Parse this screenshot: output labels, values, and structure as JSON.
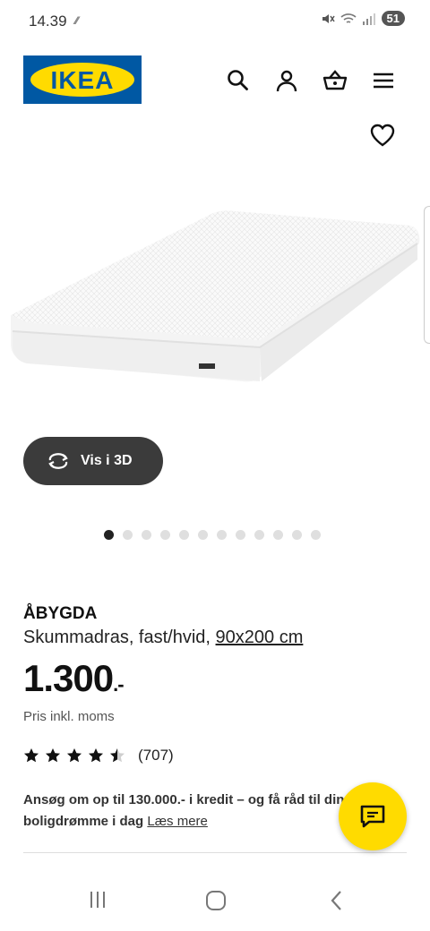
{
  "status_bar": {
    "time": "14.39",
    "battery": "51"
  },
  "header": {
    "logo_text": "IKEA"
  },
  "gallery": {
    "view3d_label": "Vis i 3D",
    "slide_count": 12,
    "active_index": 0
  },
  "product": {
    "name": "ÅBYGDA",
    "description": "Skummadras, fast/hvid, ",
    "size": "90x200 cm",
    "price_main": "1.300",
    "price_suffix": ".-",
    "vat_note": "Pris inkl. moms",
    "rating_value": 4.5,
    "rating_count": "(707)"
  },
  "promo": {
    "text": "Ansøg om op til 130.000.- i kredit – og få råd til din boligdrømme i dag",
    "link": "Læs mere"
  },
  "colors": {
    "brand_blue": "#0058a3",
    "brand_yellow": "#ffdb00"
  }
}
